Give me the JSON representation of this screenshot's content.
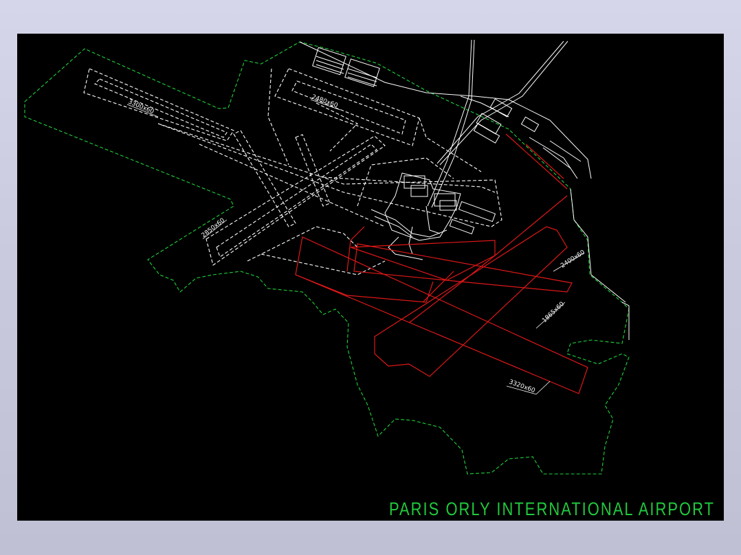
{
  "drawing": {
    "title": "PARIS ORLY INTERNATIONAL AIRPORT",
    "colors": {
      "background": "#000000",
      "boundary": "#1fd33a",
      "existing": "#ffffff",
      "proposed": "#e01818",
      "frame": "#cfd0e6"
    },
    "runway_labels": {
      "r1": "3300x60",
      "r2": "2480x60",
      "r3": "2850x60",
      "r4": "2400x60",
      "r5": "1865x60",
      "r6": "3320x60"
    }
  }
}
